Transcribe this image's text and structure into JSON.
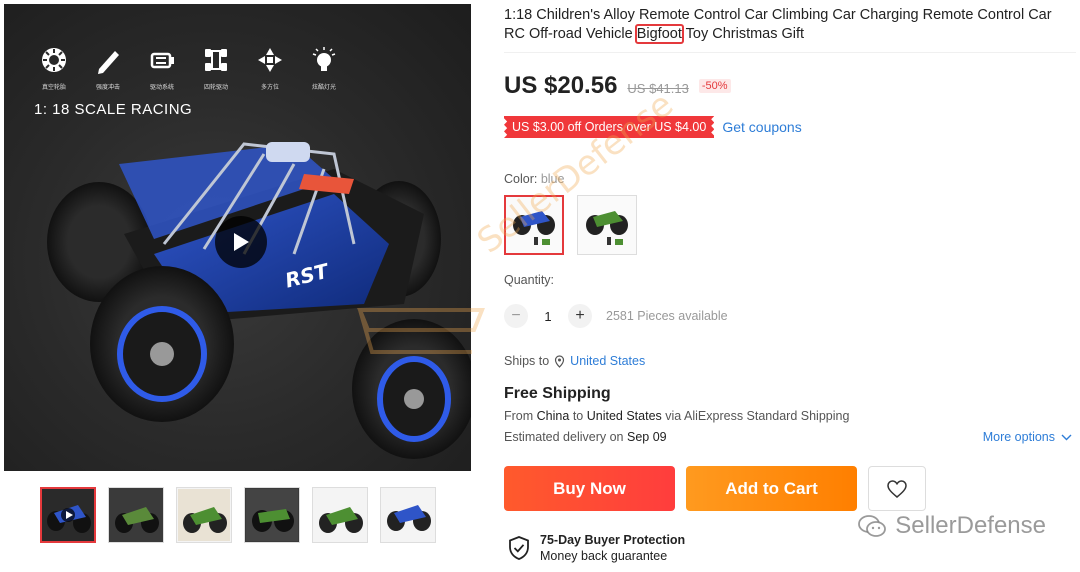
{
  "media": {
    "scale_label": "1: 18 SCALE RACING",
    "feature_icons": [
      {
        "icon": "gear-icon",
        "caption": "真空轮胎"
      },
      {
        "icon": "pen-icon",
        "caption": "强度冲击"
      },
      {
        "icon": "motor-icon",
        "caption": "驱动系统"
      },
      {
        "icon": "chassis-icon",
        "caption": "四轮驱动"
      },
      {
        "icon": "direction-icon",
        "caption": "多方位"
      },
      {
        "icon": "bulb-icon",
        "caption": "炫酷灯光"
      }
    ],
    "video_playable": true,
    "thumbnails_count": 6
  },
  "product": {
    "title_before": "1:18 Children's Alloy Remote Control Car Climbing Car Charging Remote Control Car RC Off-road Vehicle ",
    "title_highlight": "Bigfoot",
    "title_after": " Toy Christmas Gift",
    "price": "US $20.56",
    "original_price": "US $41.13",
    "discount": "-50%",
    "coupon": "US $3.00 off Orders over US $4.00",
    "get_coupons": "Get coupons"
  },
  "options": {
    "color_label": "Color:",
    "color_value": "blue",
    "colors": [
      "blue",
      "green"
    ],
    "quantity_label": "Quantity:",
    "quantity": "1",
    "minus": "−",
    "plus": "+",
    "available": "2581 Pieces available"
  },
  "shipping": {
    "ships_to_label": "Ships to",
    "ships_to_country": "United States",
    "free_shipping": "Free Shipping",
    "from_label": "From",
    "from": "China",
    "to_label": "to",
    "to": "United States",
    "via": "via AliExpress Standard Shipping",
    "eta_label": "Estimated delivery on",
    "eta_date": "Sep 09",
    "more_options": "More options"
  },
  "actions": {
    "buy_now": "Buy Now",
    "add_to_cart": "Add to Cart"
  },
  "protection": {
    "title": "75-Day Buyer Protection",
    "subtitle": "Money back guarantee"
  },
  "watermarks": {
    "diagonal": "SellerDefense",
    "corner": "SellerDefense"
  },
  "colors": {
    "accent_red": "#e4393c",
    "link_blue": "#2e7dd7",
    "buy_orange_red": "#ff4a33",
    "cart_orange": "#ff8c0f"
  }
}
